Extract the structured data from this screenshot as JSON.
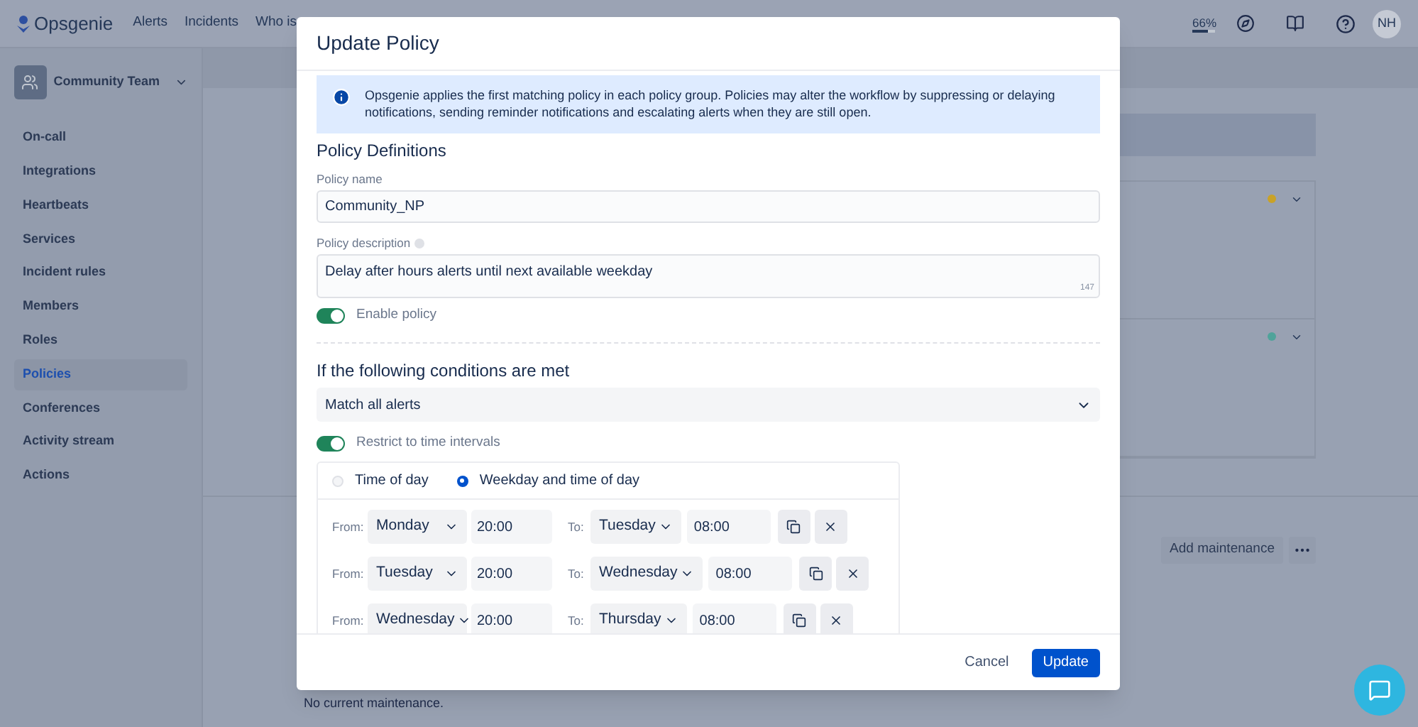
{
  "topbar": {
    "logo": "Opsgenie",
    "nav": [
      "Alerts",
      "Incidents",
      "Who is"
    ],
    "usage": {
      "label": "66%",
      "level": 0.66
    },
    "avatar": "NH"
  },
  "sidebar": {
    "team": "Community Team",
    "items": [
      {
        "label": "On-call",
        "selected": false
      },
      {
        "label": "Integrations",
        "selected": false
      },
      {
        "label": "Heartbeats",
        "selected": false
      },
      {
        "label": "Services",
        "selected": false
      },
      {
        "label": "Incident rules",
        "selected": false
      },
      {
        "label": "Members",
        "selected": false
      },
      {
        "label": "Roles",
        "selected": false
      },
      {
        "label": "Policies",
        "selected": true
      },
      {
        "label": "Conferences",
        "selected": false
      },
      {
        "label": "Activity stream",
        "selected": false
      },
      {
        "label": "Actions",
        "selected": false
      }
    ]
  },
  "background": {
    "status_rows": [
      {
        "color": "#c9a227"
      },
      {
        "color": "#4fa39a"
      }
    ],
    "add_maintenance": "Add maintenance",
    "empty_text": "No current maintenance."
  },
  "dialog": {
    "title": "Update Policy",
    "info": "Opsgenie applies the first matching policy in each policy group. Policies may alter the workflow by suppressing or delaying notifications, sending reminder notifications and escalating alerts when they are still open.",
    "definitions_title": "Policy Definitions",
    "name_label": "Policy name",
    "name_value": "Community_NP",
    "description_label": "Policy description",
    "description_value": "Delay after hours alerts until next available weekday",
    "description_count": "147",
    "enable_toggle": {
      "label": "Enable policy",
      "on": true
    },
    "conditions_title": "If the following conditions are met",
    "match_select": "Match all alerts",
    "restrict_toggle": {
      "label": "Restrict to time intervals",
      "on": true
    },
    "modes": [
      {
        "label": "Time of day",
        "selected": false
      },
      {
        "label": "Weekday and time of day",
        "selected": true
      }
    ],
    "intervals": [
      {
        "from_label": "From:",
        "from_day": "Monday",
        "from_time": "20:00",
        "to_label": "To:",
        "to_day": "Tuesday",
        "to_time": "08:00"
      },
      {
        "from_label": "From:",
        "from_day": "Tuesday",
        "from_time": "20:00",
        "to_label": "To:",
        "to_day": "Wednesday",
        "to_time": "08:00"
      },
      {
        "from_label": "From:",
        "from_day": "Wednesday",
        "from_time": "20:00",
        "to_label": "To:",
        "to_day": "Thursday",
        "to_time": "08:00"
      }
    ],
    "cancel": "Cancel",
    "update": "Update"
  }
}
